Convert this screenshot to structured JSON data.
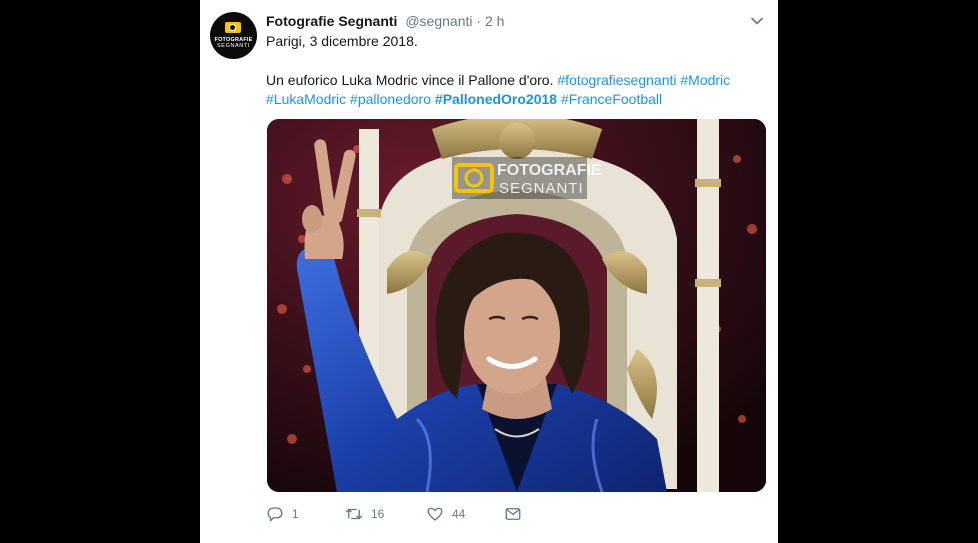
{
  "tweet": {
    "author_name": "Fotografie Segnanti",
    "handle": "@segnanti",
    "separator": "·",
    "time": "2 h",
    "text_line1": "Parigi, 3 dicembre 2018.",
    "text_body": "Un euforico Luka Modric vince il Pallone d'oro.",
    "hashtags": [
      "#fotografiesegnanti",
      "#Modric",
      "#LukaModric",
      "#pallonedoro",
      "#PallonedOro2018",
      "#FranceFootball"
    ],
    "avatar": {
      "line1": "FOTOGRAFIE",
      "line2": "SEGNANTI"
    },
    "media": {
      "watermark_line1": "FOTOGRAFIE",
      "watermark_line2": "SEGNANTI",
      "watermark_icon": "camera-icon"
    },
    "actions": {
      "replies": "1",
      "retweets": "16",
      "likes": "44"
    }
  },
  "colors": {
    "accent": "#1b95e0",
    "text": "#14171a",
    "secondary": "#657786",
    "watermark_yellow": "#f3c40d"
  },
  "icons": [
    "chevron-down-icon",
    "reply-icon",
    "retweet-icon",
    "like-icon",
    "message-icon",
    "camera-icon"
  ]
}
